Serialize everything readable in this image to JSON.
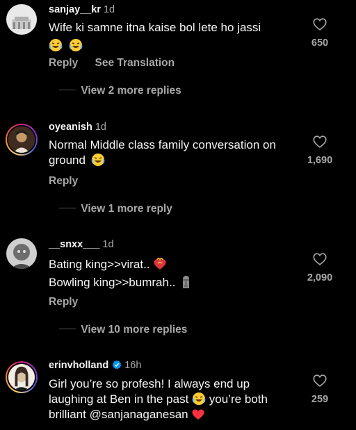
{
  "comments": [
    {
      "username": "sanjay__kr",
      "time": "1d",
      "text": "Wife ki samne itna kaise bol lete ho jassi",
      "likes": "650",
      "reply_label": "Reply",
      "translate_label": "See Translation",
      "view_replies": "View 2 more replies"
    },
    {
      "username": "oyeanish",
      "time": "1d",
      "text_line1": "Normal Middle class family conversation on",
      "text_line2": "ground",
      "likes": "1,690",
      "reply_label": "Reply",
      "view_replies": "View 1 more reply"
    },
    {
      "username": "__snxx___",
      "time": "1d",
      "text_line1": "Bating king>>virat..",
      "text_line2": "Bowling king>>bumrah..",
      "likes": "2,090",
      "reply_label": "Reply",
      "view_replies": "View 10 more replies"
    },
    {
      "username": "erinvholland",
      "time": "16h",
      "verified": true,
      "text_line1": "Girl you’re so profesh! I always end up",
      "text_line2a": "laughing at Ben in the past",
      "text_line2b": "you’re both",
      "text_line3": "brilliant @sanjanaganesan",
      "likes": "259"
    }
  ],
  "colors": {
    "background": "#000000",
    "primary_text": "#f5f5f5",
    "secondary_text": "#a8a8a8",
    "verified_blue": "#0095f6",
    "heart_red": "#ff3040"
  },
  "icons": [
    "heart-outline-icon",
    "verified-badge-icon",
    "laughing-emoji",
    "burning-heart-emoji",
    "moai-emoji",
    "red-heart-emoji"
  ]
}
